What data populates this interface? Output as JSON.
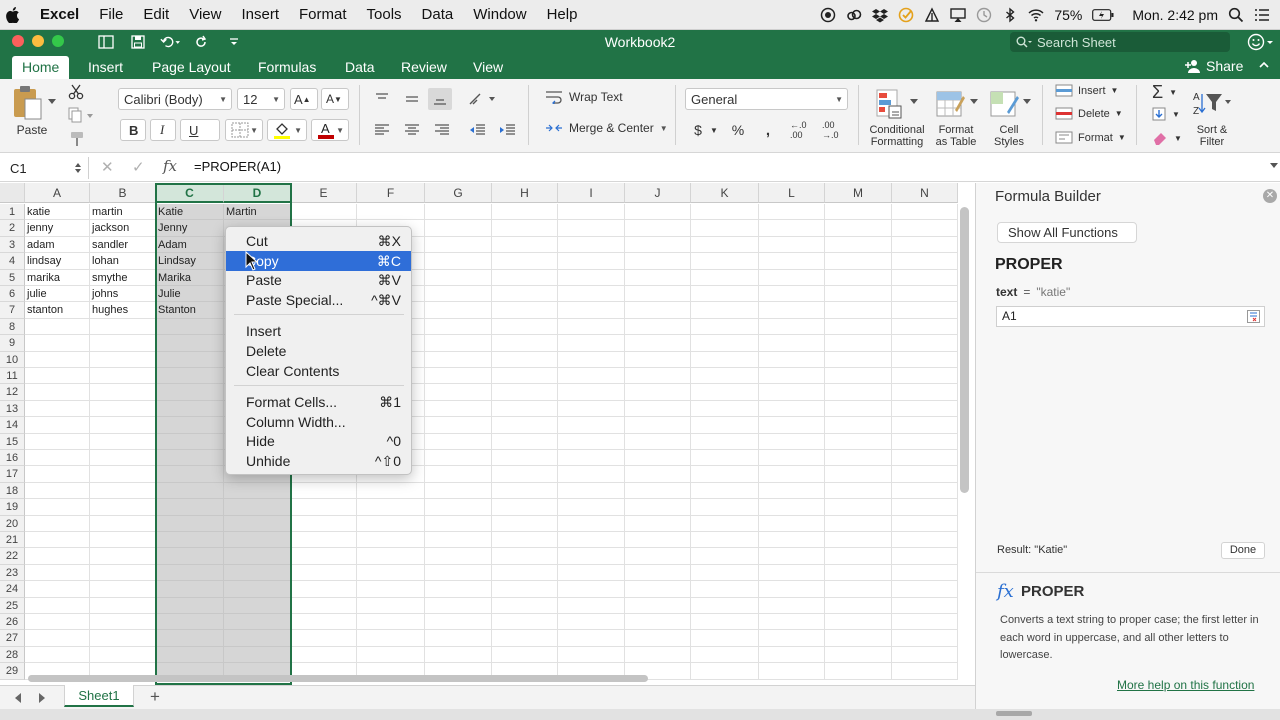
{
  "menubar": {
    "app_name": "Excel",
    "items": [
      "File",
      "Edit",
      "View",
      "Insert",
      "Format",
      "Tools",
      "Data",
      "Window",
      "Help"
    ],
    "battery": "75%",
    "clock": "Mon. 2:42 pm"
  },
  "window": {
    "title": "Workbook2",
    "search_placeholder": "Search Sheet",
    "share_label": "Share"
  },
  "tabs": [
    "Home",
    "Insert",
    "Page Layout",
    "Formulas",
    "Data",
    "Review",
    "View"
  ],
  "active_tab": "Home",
  "ribbon": {
    "paste_label": "Paste",
    "font_name": "Calibri (Body)",
    "font_size": "12",
    "bold": "B",
    "italic": "I",
    "underline": "U",
    "wrap_text": "Wrap Text",
    "merge_center": "Merge & Center",
    "number_format": "General",
    "currency": "$",
    "percent": "%",
    "comma": ",",
    "increase_decimal": "←.0 .00",
    "decrease_decimal": ".00 →.0",
    "conditional_formatting": [
      "Conditional",
      "Formatting"
    ],
    "format_as_table": [
      "Format",
      "as Table"
    ],
    "cell_styles": [
      "Cell",
      "Styles"
    ],
    "insert": "Insert",
    "delete": "Delete",
    "format": "Format",
    "sort_filter": [
      "Sort &",
      "Filter"
    ]
  },
  "formula_bar": {
    "name_box": "C1",
    "formula": "=PROPER(A1)"
  },
  "columns": [
    "A",
    "B",
    "C",
    "D",
    "E",
    "F",
    "G",
    "H",
    "I",
    "J",
    "K",
    "L",
    "M",
    "N"
  ],
  "rows": [
    "1",
    "2",
    "3",
    "4",
    "5",
    "6",
    "7",
    "8",
    "9",
    "10",
    "11",
    "12",
    "13",
    "14",
    "15",
    "16",
    "17",
    "18",
    "19",
    "20",
    "21",
    "22",
    "23",
    "24",
    "25",
    "26",
    "27",
    "28",
    "29"
  ],
  "cells": {
    "A": [
      "katie",
      "jenny",
      "adam",
      "lindsay",
      "marika",
      "julie",
      "stanton"
    ],
    "B": [
      "martin",
      "jackson",
      "sandler",
      "lohan",
      "smythe",
      "johns",
      "hughes"
    ],
    "C": [
      "Katie",
      "Jenny",
      "Adam",
      "Lindsay",
      "Marika",
      "Julie",
      "Stanton"
    ],
    "D": [
      "Martin"
    ]
  },
  "context_menu": {
    "groups": [
      [
        {
          "label": "Cut",
          "shortcut": "⌘X"
        },
        {
          "label": "Copy",
          "shortcut": "⌘C",
          "highlighted": true
        },
        {
          "label": "Paste",
          "shortcut": "⌘V"
        },
        {
          "label": "Paste Special...",
          "shortcut": "^⌘V"
        }
      ],
      [
        {
          "label": "Insert",
          "shortcut": ""
        },
        {
          "label": "Delete",
          "shortcut": ""
        },
        {
          "label": "Clear Contents",
          "shortcut": ""
        }
      ],
      [
        {
          "label": "Format Cells...",
          "shortcut": "⌘1"
        },
        {
          "label": "Column Width...",
          "shortcut": ""
        },
        {
          "label": "Hide",
          "shortcut": "^0"
        },
        {
          "label": "Unhide",
          "shortcut": "^⇧0"
        }
      ]
    ]
  },
  "sheet_tab": "Sheet1",
  "formula_builder": {
    "title": "Formula Builder",
    "show_all": "Show All Functions",
    "function_name": "PROPER",
    "arg_name": "text",
    "arg_equals": "=",
    "arg_result": "\"katie\"",
    "arg_input": "A1",
    "result": "Result: \"Katie\"",
    "done": "Done",
    "description": "Converts a text string to proper case; the first letter in each word in uppercase, and all other letters to lowercase.",
    "help_link": "More help on this function"
  },
  "colors": {
    "excel_green": "#217346",
    "selection_gray": "#d6d6d6",
    "menu_highlight": "#2f6ed8"
  }
}
